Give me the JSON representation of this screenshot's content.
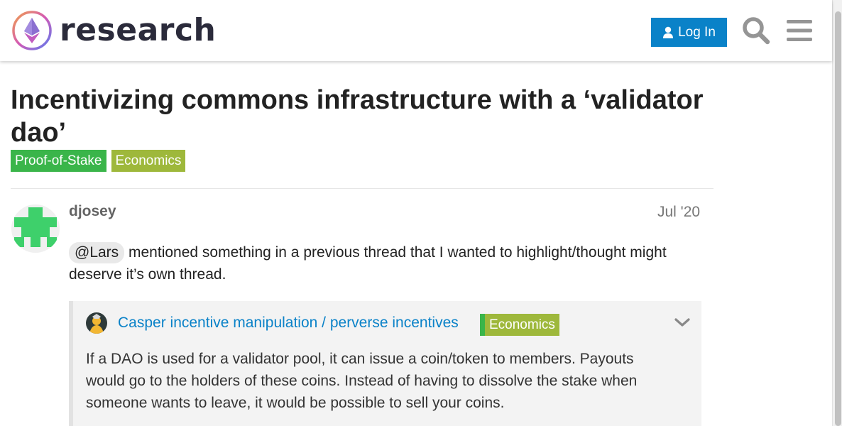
{
  "header": {
    "site_name": "research",
    "login_label": "Log In",
    "icons": {
      "logo": "ethereum-logo-icon",
      "user": "user-icon",
      "search": "search-icon",
      "menu": "hamburger-menu-icon"
    }
  },
  "topic": {
    "title": "Incentivizing commons infrastructure with a ‘validator dao’",
    "tags": [
      {
        "label": "Proof-of-Stake",
        "color": "#3ab54a"
      },
      {
        "label": "Economics",
        "color": "#9eb83b"
      }
    ]
  },
  "post": {
    "author": "djosey",
    "date": "Jul '20",
    "mention": "@Lars",
    "text": " mentioned something in a previous thread that I wanted to highlight/thought might deserve it’s own thread.",
    "onebox": {
      "title": "Casper incentive manipulation / perverse incentives",
      "tag": "Economics",
      "text": "If a DAO is used for a validator pool, it can issue a coin/token to members. Payouts would go to the holders of these coins. Instead of having to dissolve the stake when someone wants to leave, it would be possible to sell your coins."
    }
  },
  "colors": {
    "accent": "#0a82c8",
    "tag_proof_of_stake": "#3ab54a",
    "tag_economics": "#9eb83b",
    "avatar_green": "#3ed06b"
  }
}
